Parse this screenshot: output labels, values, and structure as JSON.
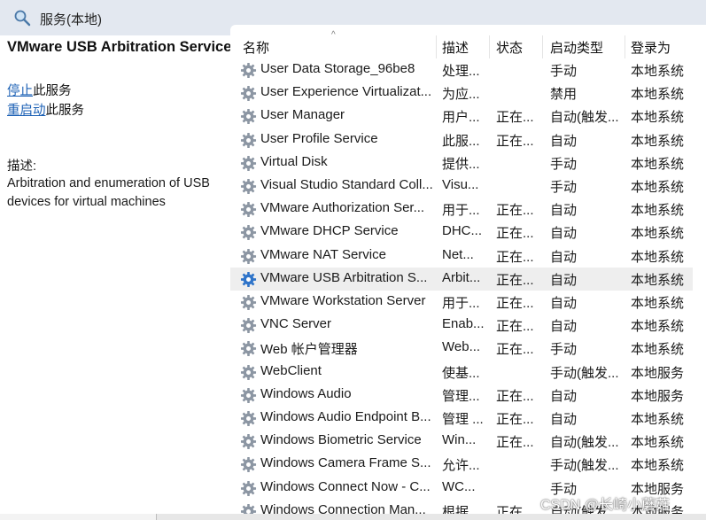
{
  "window": {
    "title": "服务(本地)"
  },
  "left_panel": {
    "service_title": "VMware USB Arbitration Service",
    "stop_link": "停止",
    "stop_suffix": "此服务",
    "restart_link": "重启动",
    "restart_suffix": "此服务",
    "description_label": "描述:",
    "description": "Arbitration and enumeration of USB devices for virtual machines"
  },
  "table": {
    "headers": {
      "name": "名称",
      "description": "描述",
      "status": "状态",
      "startup": "启动类型",
      "logon": "登录为"
    },
    "sort_indicator": "^",
    "rows": [
      {
        "name": "User Data Storage_96be8",
        "description": "处理...",
        "status": "",
        "startup": "手动",
        "logon": "本地系统"
      },
      {
        "name": "User Experience Virtualizat...",
        "description": "为应...",
        "status": "",
        "startup": "禁用",
        "logon": "本地系统"
      },
      {
        "name": "User Manager",
        "description": "用户...",
        "status": "正在...",
        "startup": "自动(触发...",
        "logon": "本地系统"
      },
      {
        "name": "User Profile Service",
        "description": "此服...",
        "status": "正在...",
        "startup": "自动",
        "logon": "本地系统"
      },
      {
        "name": "Virtual Disk",
        "description": "提供...",
        "status": "",
        "startup": "手动",
        "logon": "本地系统"
      },
      {
        "name": "Visual Studio Standard Coll...",
        "description": "Visu...",
        "status": "",
        "startup": "手动",
        "logon": "本地系统"
      },
      {
        "name": "VMware Authorization Ser...",
        "description": "用于...",
        "status": "正在...",
        "startup": "自动",
        "logon": "本地系统"
      },
      {
        "name": "VMware DHCP Service",
        "description": "DHC...",
        "status": "正在...",
        "startup": "自动",
        "logon": "本地系统"
      },
      {
        "name": "VMware NAT Service",
        "description": "Net...",
        "status": "正在...",
        "startup": "自动",
        "logon": "本地系统"
      },
      {
        "name": "VMware USB Arbitration S...",
        "description": "Arbit...",
        "status": "正在...",
        "startup": "自动",
        "logon": "本地系统",
        "selected": true
      },
      {
        "name": "VMware Workstation Server",
        "description": "用于...",
        "status": "正在...",
        "startup": "自动",
        "logon": "本地系统"
      },
      {
        "name": "VNC Server",
        "description": "Enab...",
        "status": "正在...",
        "startup": "自动",
        "logon": "本地系统"
      },
      {
        "name": "Web 帐户管理器",
        "description": "Web...",
        "status": "正在...",
        "startup": "手动",
        "logon": "本地系统"
      },
      {
        "name": "WebClient",
        "description": "使基...",
        "status": "",
        "startup": "手动(触发...",
        "logon": "本地服务"
      },
      {
        "name": "Windows Audio",
        "description": "管理...",
        "status": "正在...",
        "startup": "自动",
        "logon": "本地服务"
      },
      {
        "name": "Windows Audio Endpoint B...",
        "description": "管理 ...",
        "status": "正在...",
        "startup": "自动",
        "logon": "本地系统"
      },
      {
        "name": "Windows Biometric Service",
        "description": "Win...",
        "status": "正在...",
        "startup": "自动(触发...",
        "logon": "本地系统"
      },
      {
        "name": "Windows Camera Frame S...",
        "description": "允许...",
        "status": "",
        "startup": "手动(触发...",
        "logon": "本地系统"
      },
      {
        "name": "Windows Connect Now - C...",
        "description": "WC...",
        "status": "",
        "startup": "手动",
        "logon": "本地服务"
      },
      {
        "name": "Windows Connection Man...",
        "description": "根据...",
        "status": "正在...",
        "startup": "自动(触发...",
        "logon": "本地服务"
      }
    ]
  },
  "watermark": "CSDN @长崎小蘑菇",
  "icons": {
    "title": "services-magnifier-icon",
    "row": "service-gear-icon"
  },
  "colors": {
    "titlebar": "#e3e8f0",
    "link": "#1a5fb4",
    "selected_row": "#eeeeee"
  }
}
